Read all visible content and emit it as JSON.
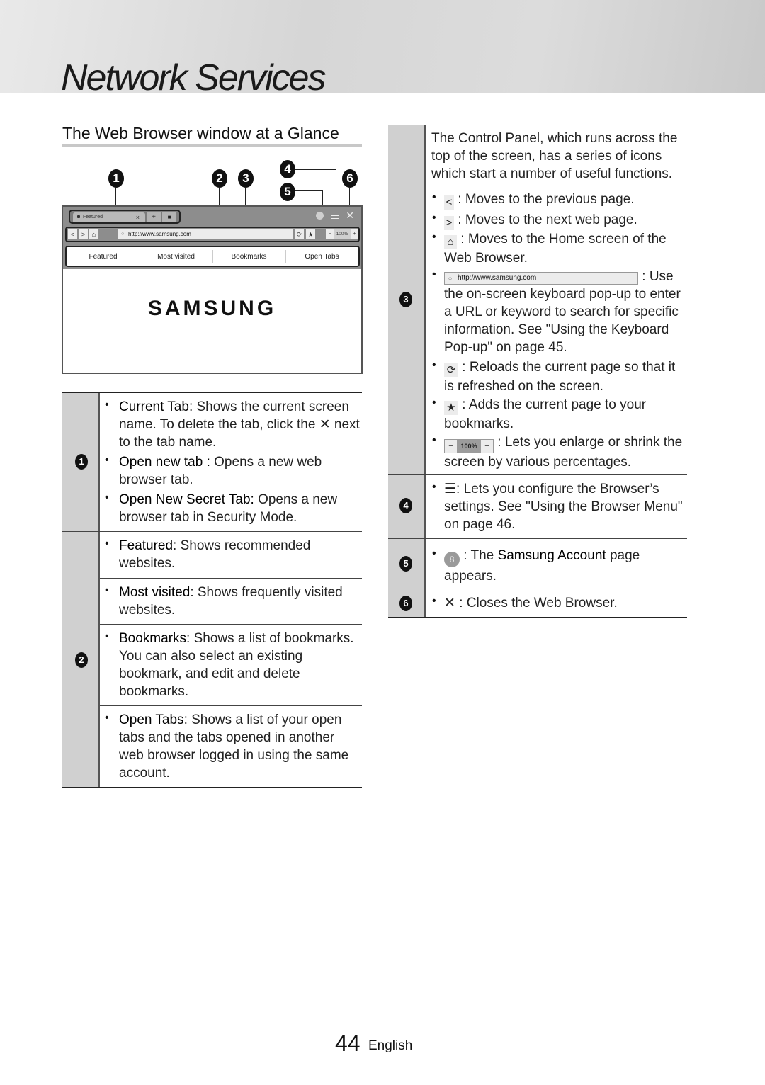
{
  "header": {
    "chapter_title": "Network Services"
  },
  "section": {
    "title": "The Web Browser window at a Glance"
  },
  "callouts": [
    "1",
    "2",
    "3",
    "4",
    "5",
    "6"
  ],
  "browser": {
    "tab_label": "Featured",
    "tab_close": "×",
    "new_tab": "+",
    "secret_tab": "🔒",
    "back": "<",
    "forward": ">",
    "home": "⌂",
    "url": "http://www.samsung.com",
    "search_glyph": "⚲",
    "reload": "⟳",
    "bookmark": "★",
    "zoom_minus": "−",
    "zoom_value": "100%",
    "zoom_plus": "+",
    "close": "✕",
    "nav_tabs": [
      "Featured",
      "Most visited",
      "Bookmarks",
      "Open Tabs"
    ],
    "logo": "SAMSUNG"
  },
  "left_table": {
    "rows": [
      {
        "number": "1",
        "items": [
          {
            "term": "Current Tab",
            "text": ": Shows the current screen name. To delete the tab, click the ✕ next to the tab name."
          },
          {
            "term": "Open new tab :",
            "text": " Opens a new web browser tab."
          },
          {
            "term": "Open New Secret Tab:",
            "text": " Opens a new browser tab in Security Mode."
          }
        ]
      },
      {
        "number": "2",
        "items": [
          {
            "term": "Featured",
            "text": ": Shows recommended websites."
          },
          {
            "term": "Most visited",
            "text": ": Shows frequently visited websites."
          },
          {
            "term": "Bookmarks",
            "text": ": Shows a list of bookmarks. You can also select an existing bookmark, and edit and delete bookmarks."
          },
          {
            "term": "Open Tabs",
            "text": ": Shows a list of your open tabs and the tabs opened in another web browser logged in using the same account."
          }
        ]
      }
    ]
  },
  "right_table": {
    "row3": {
      "number": "3",
      "intro": "The Control Panel, which runs across the top of the screen, has a series of icons which start a number of useful functions.",
      "items": [
        {
          "icon": "<",
          "text": " : Moves to the previous page."
        },
        {
          "icon": ">",
          "text": " : Moves to the next web page."
        },
        {
          "icon": "⌂",
          "text": " : Moves to the Home screen of the Web Browser."
        },
        {
          "icon": "http://www.samsung.com",
          "text": " : Use the on-screen keyboard pop-up to enter a URL or keyword to search for specific information. See \"Using the Keyboard Pop-up\" on page 45."
        },
        {
          "icon": "⟳",
          "text": " : Reloads the current page so that it is refreshed on the screen."
        },
        {
          "icon": "★",
          "text": " : Adds the current page to your bookmarks."
        },
        {
          "icon": "100%",
          "text": " : Lets you enlarge or shrink the screen by various percentages."
        }
      ]
    },
    "row4": {
      "number": "4",
      "icon": "☰",
      "text": ": Lets you configure the Browser’s settings. See \"Using the Browser Menu\" on page 46."
    },
    "row5": {
      "number": "5",
      "icon": "👤",
      "pre": " : The ",
      "term": "Samsung Account",
      "post": " page appears."
    },
    "row6": {
      "number": "6",
      "icon": "✕",
      "text": " : Closes the Web Browser."
    }
  },
  "footer": {
    "page_number": "44",
    "language": "English"
  }
}
